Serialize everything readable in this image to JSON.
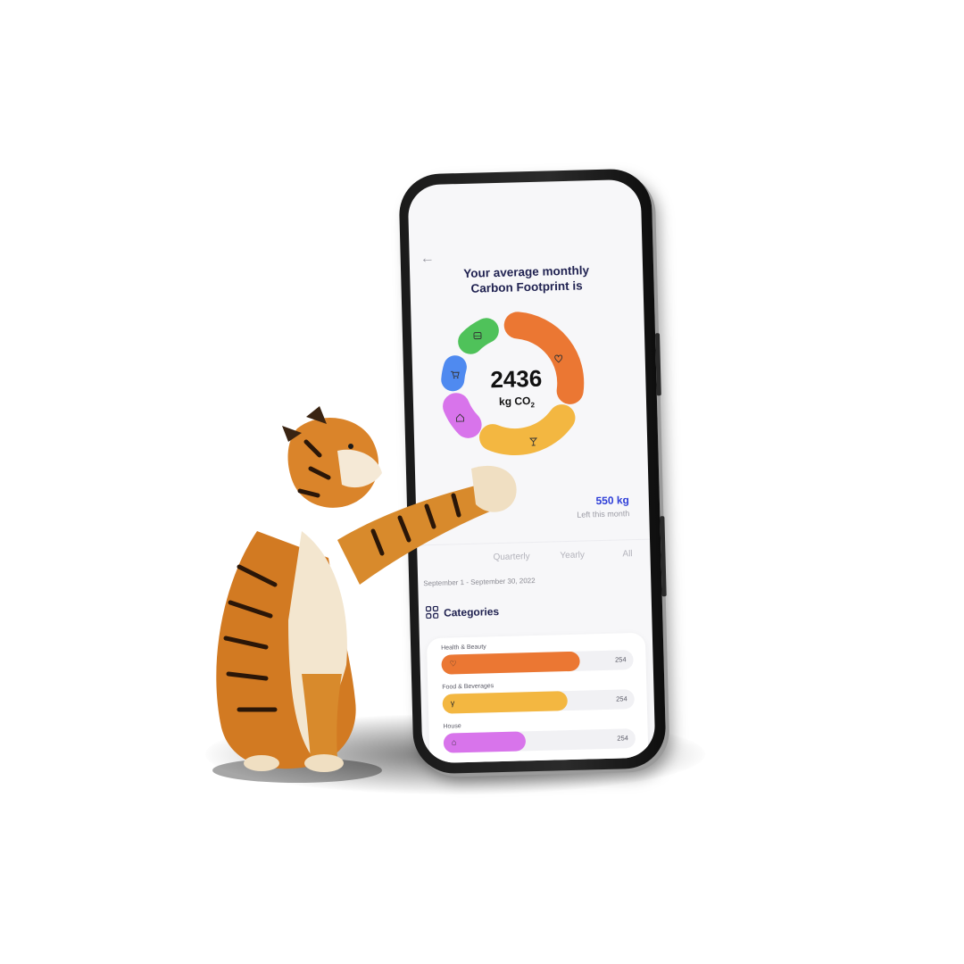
{
  "screen": {
    "headline_line1": "Your average monthly",
    "headline_line2": "Carbon Footprint is",
    "total_value": "2436",
    "total_unit": "kg CO",
    "total_unit_sub": "2",
    "remaining_value": "550 kg",
    "remaining_caption": "Left this month"
  },
  "donut_segments": [
    {
      "name": "health-beauty",
      "color": "#EB7733",
      "icon": "heart-icon"
    },
    {
      "name": "food-beverages",
      "color": "#F3B741",
      "icon": "cocktail-icon"
    },
    {
      "name": "house",
      "color": "#D874EB",
      "icon": "house-icon"
    },
    {
      "name": "shopping",
      "color": "#4F8AF0",
      "icon": "cart-icon"
    },
    {
      "name": "transport",
      "color": "#4FC25A",
      "icon": "bus-icon"
    }
  ],
  "tabs": [
    "Quarterly",
    "Yearly",
    "All"
  ],
  "date_range": "September 1 - September 30, 2022",
  "categories_title": "Categories",
  "categories": [
    {
      "label": "Health & Beauty",
      "value": "254",
      "color": "#EB7733",
      "fill": 0.72
    },
    {
      "label": "Food & Beverages",
      "value": "254",
      "color": "#F3B741",
      "fill": 0.65
    },
    {
      "label": "House",
      "value": "254",
      "color": "#D874EB",
      "fill": 0.43
    }
  ]
}
